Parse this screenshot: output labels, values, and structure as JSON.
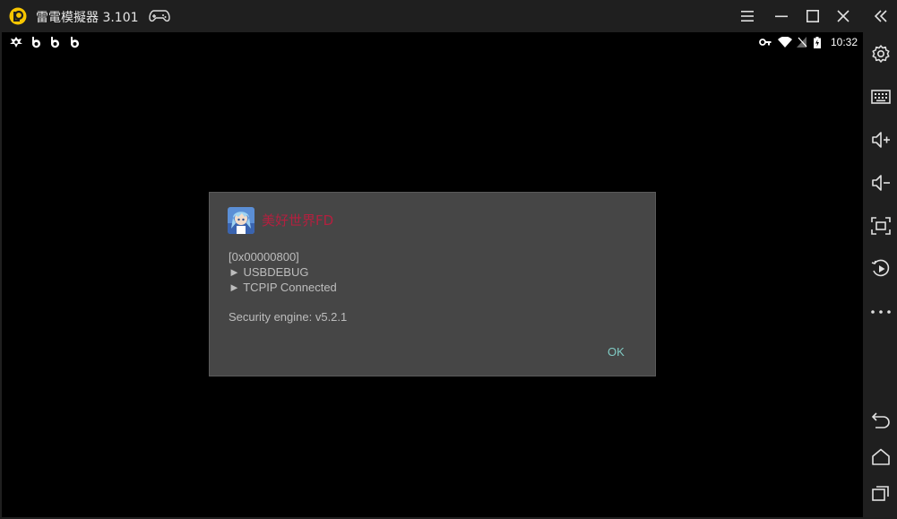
{
  "window": {
    "title": "雷電模擬器 3.101"
  },
  "titlebar": {
    "icons": [
      "ldplayer-logo-icon",
      "gamepad-icon",
      "menu-icon",
      "minimize-icon",
      "maximize-icon",
      "close-icon",
      "collapse-sidebar-icon"
    ]
  },
  "statusbar": {
    "time": "10:32",
    "left_icons": [
      "game-notification-icon",
      "app-notification-icon",
      "app-notification-icon",
      "app-notification-icon"
    ],
    "right_icons": [
      "key-icon",
      "wifi-icon",
      "no-signal-icon",
      "battery-charging-icon"
    ]
  },
  "sidebar": {
    "items": [
      {
        "icon": "settings-icon"
      },
      {
        "icon": "keyboard-icon"
      },
      {
        "icon": "volume-up-icon"
      },
      {
        "icon": "volume-down-icon"
      },
      {
        "icon": "fullscreen-icon"
      },
      {
        "icon": "screen-record-icon"
      },
      {
        "icon": "more-icon"
      },
      {
        "icon": "back-icon"
      },
      {
        "icon": "home-icon"
      },
      {
        "icon": "recent-apps-icon"
      }
    ]
  },
  "dialog": {
    "title": "美好世界FD",
    "lines": [
      "[0x00000800]",
      "► USBDEBUG",
      "► TCPIP Connected",
      "Security engine: v5.2.1"
    ],
    "ok_label": "OK"
  },
  "colors": {
    "chrome_bg": "#1f1f1f",
    "screen_bg": "#000000",
    "dialog_bg": "#464646",
    "dialog_title": "#b3203f",
    "accent_ok": "#80cbc4",
    "logo_yellow": "#f6c500"
  }
}
